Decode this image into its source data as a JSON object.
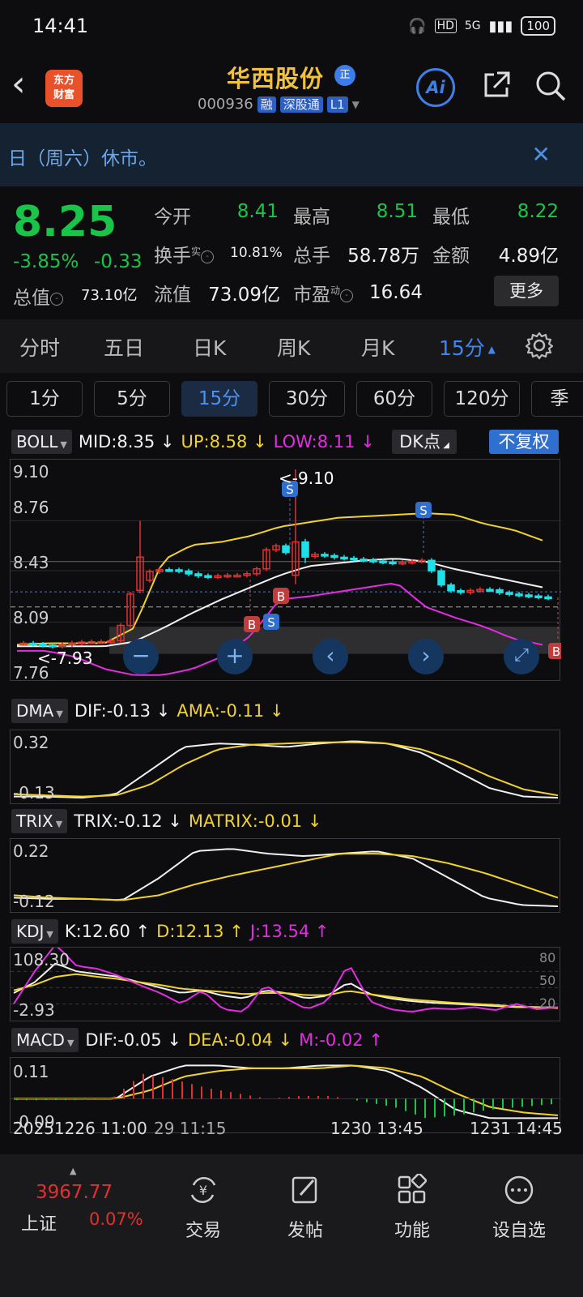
{
  "status": {
    "time": "14:41",
    "hd": "HD",
    "net": "5G",
    "battery": "100"
  },
  "header": {
    "logo_line1": "东方",
    "logo_line2": "财富",
    "stock_name": "华西股份",
    "name_badge": "正",
    "code": "000936",
    "tags": [
      "融",
      "深股通",
      "L1"
    ],
    "ai_label": "Ai"
  },
  "notice": {
    "text": "日（周六）休市。"
  },
  "quote": {
    "price": "8.25",
    "change_pct": "-3.85%",
    "change_abs": "-0.33",
    "open_label": "今开",
    "open": "8.41",
    "high_label": "最高",
    "high": "8.51",
    "low_label": "最低",
    "low": "8.22",
    "turnover_label": "换手",
    "turnover_sup": "实",
    "turnover": "10.81%",
    "volume_label": "总手",
    "volume": "58.78万",
    "amount_label": "金额",
    "amount": "4.89亿",
    "mktcap_label": "总值",
    "mktcap": "73.10亿",
    "float_label": "流值",
    "float": "73.09亿",
    "pe_label": "市盈",
    "pe_sup": "动",
    "pe": "16.64",
    "more": "更多"
  },
  "period_tabs": [
    "分时",
    "五日",
    "日K",
    "周K",
    "月K",
    "15分"
  ],
  "minute_tabs": [
    "1分",
    "5分",
    "15分",
    "30分",
    "60分",
    "120分",
    "季"
  ],
  "boll": {
    "name": "BOLL",
    "mid": "MID:8.35",
    "up": "UP:8.58",
    "low": "LOW:8.11",
    "y_labels": [
      "9.10",
      "8.76",
      "8.43",
      "8.09",
      "7.76"
    ],
    "max_mark": "<-9.10",
    "min_mark": "<-7.93",
    "dk": "DK点",
    "fq": "不复权",
    "sig_s": "S",
    "sig_b": "B"
  },
  "dma": {
    "name": "DMA",
    "dif": "DIF:-0.13",
    "ama": "AMA:-0.11",
    "y_labels": [
      "0.32",
      "-0.13"
    ]
  },
  "trix": {
    "name": "TRIX",
    "trix": "TRIX:-0.12",
    "matrix": "MATRIX:-0.01",
    "y_labels": [
      "0.22",
      "-0.12"
    ]
  },
  "kdj": {
    "name": "KDJ",
    "k": "K:12.60",
    "d": "D:12.13",
    "j": "J:13.54",
    "y_labels": [
      "108.30",
      "-2.93"
    ],
    "r_labels": [
      "80",
      "50",
      "20"
    ]
  },
  "macd": {
    "name": "MACD",
    "dif": "DIF:-0.05",
    "dea": "DEA:-0.04",
    "m": "M:-0.02",
    "y_labels": [
      "0.11",
      "-0.09"
    ]
  },
  "arrows": {
    "down": "↓",
    "up": "↑"
  },
  "time_axis": [
    "20251226 11:00",
    "29 11:15",
    "1230 13:45",
    "1231 14:45"
  ],
  "bottom": {
    "index_value": "3967.77",
    "index_name": "上证",
    "index_change": "0.07%",
    "nav": [
      "交易",
      "发帖",
      "功能",
      "设自选"
    ]
  },
  "colors": {
    "up": "#e03131",
    "down": "#19c548",
    "accent": "#3d87f2",
    "cyan": "#1ee0e6",
    "yellow": "#f2d32a",
    "magenta": "#e22de2"
  }
}
